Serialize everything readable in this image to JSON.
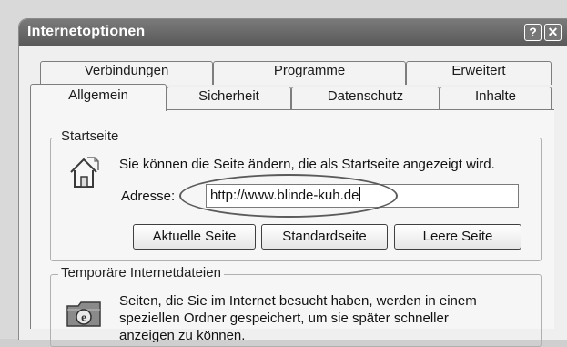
{
  "window": {
    "title": "Internetoptionen",
    "help_label": "?",
    "close_label": "✕"
  },
  "tabs_back": [
    {
      "label": "Verbindungen"
    },
    {
      "label": "Programme"
    },
    {
      "label": "Erweitert"
    }
  ],
  "tabs_front": [
    {
      "label": "Allgemein",
      "active": true
    },
    {
      "label": "Sicherheit",
      "active": false
    },
    {
      "label": "Datenschutz",
      "active": false
    },
    {
      "label": "Inhalte",
      "active": false
    }
  ],
  "startseite": {
    "group_label": "Startseite",
    "description": "Sie können die Seite ändern, die als Startseite angezeigt wird.",
    "address_label": "Adresse:",
    "address_value": "http://www.blinde-kuh.de",
    "buttons": {
      "current": "Aktuelle Seite",
      "default": "Standardseite",
      "blank": "Leere Seite"
    },
    "icon": "house-icon"
  },
  "temp_files": {
    "group_label": "Temporäre Internetdateien",
    "description_line1": "Seiten, die Sie im Internet besucht haben, werden in einem",
    "description_line2": "speziellen Ordner gespeichert, um sie später schneller",
    "description_line3": "anzeigen zu können.",
    "icon": "ie-folder-icon"
  },
  "colors": {
    "titlebar": "#666666",
    "dialog_bg": "#f6f6f6",
    "highlight_ellipse": "#5a5a5a"
  }
}
